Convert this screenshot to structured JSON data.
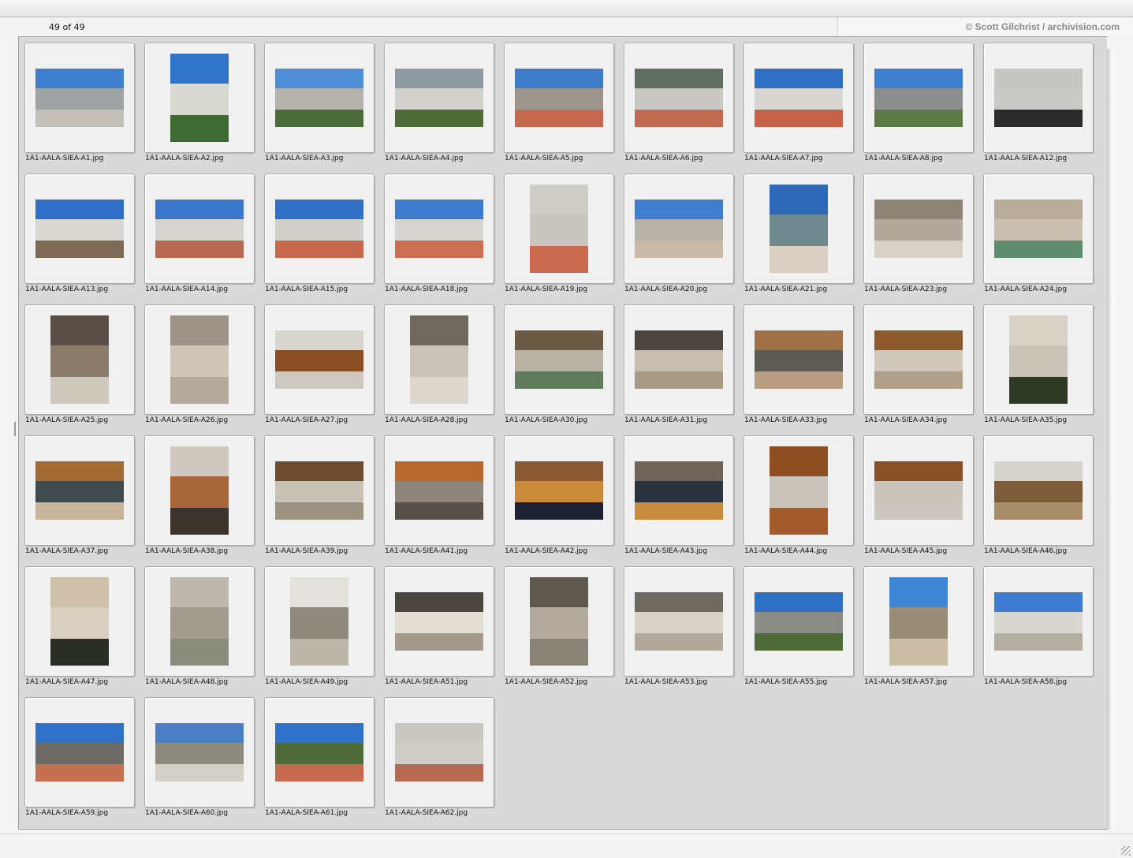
{
  "header": {
    "counter": "49 of 49",
    "credit": "© Scott Gilchrist / archivision.com"
  },
  "thumbnails": [
    {
      "file": "1A1-AALA-SIEA-A1.jpg",
      "orientation": "landscape",
      "colors": [
        "#3e7fd0",
        "#9fa3a4",
        "#c4c0b8"
      ]
    },
    {
      "file": "1A1-AALA-SIEA-A2.jpg",
      "orientation": "portrait",
      "colors": [
        "#2f74c9",
        "#d9d9d4",
        "#3f6a34"
      ]
    },
    {
      "file": "1A1-AALA-SIEA-A3.jpg",
      "orientation": "landscape",
      "colors": [
        "#4f8fd8",
        "#b5b2ab",
        "#4a6b3a"
      ]
    },
    {
      "file": "1A1-AALA-SIEA-A4.jpg",
      "orientation": "landscape",
      "colors": [
        "#8e9a9f",
        "#d2d0cb",
        "#4d6b36"
      ]
    },
    {
      "file": "1A1-AALA-SIEA-A5.jpg",
      "orientation": "landscape",
      "colors": [
        "#3d7cc8",
        "#9d958c",
        "#c56a4e"
      ]
    },
    {
      "file": "1A1-AALA-SIEA-A6.jpg",
      "orientation": "landscape",
      "colors": [
        "#5f6e60",
        "#c9c8c3",
        "#c26a52"
      ]
    },
    {
      "file": "1A1-AALA-SIEA-A7.jpg",
      "orientation": "landscape",
      "colors": [
        "#2f6fc5",
        "#d8d7d2",
        "#c56348"
      ]
    },
    {
      "file": "1A1-AALA-SIEA-A8.jpg",
      "orientation": "landscape",
      "colors": [
        "#3d7fcf",
        "#8b8e8c",
        "#5b7a45"
      ]
    },
    {
      "file": "1A1-AALA-SIEA-A12.jpg",
      "orientation": "landscape",
      "colors": [
        "#c6c6c2",
        "#c9c9c5",
        "#2b2b2b"
      ]
    },
    {
      "file": "1A1-AALA-SIEA-A13.jpg",
      "orientation": "landscape",
      "colors": [
        "#2f6ec7",
        "#d9d8d3",
        "#7c6a52"
      ]
    },
    {
      "file": "1A1-AALA-SIEA-A14.jpg",
      "orientation": "landscape",
      "colors": [
        "#3b78cb",
        "#d6d4cf",
        "#b86a50"
      ]
    },
    {
      "file": "1A1-AALA-SIEA-A15.jpg",
      "orientation": "landscape",
      "colors": [
        "#2f6fc6",
        "#d1cfc9",
        "#c7674c"
      ]
    },
    {
      "file": "1A1-AALA-SIEA-A18.jpg",
      "orientation": "landscape",
      "colors": [
        "#3d7bcc",
        "#d7d5d0",
        "#cb6e51"
      ]
    },
    {
      "file": "1A1-AALA-SIEA-A19.jpg",
      "orientation": "portrait",
      "colors": [
        "#cfcdc7",
        "#c9c6c0",
        "#c9694d"
      ]
    },
    {
      "file": "1A1-AALA-SIEA-A20.jpg",
      "orientation": "landscape",
      "colors": [
        "#3f7ecf",
        "#b7b2a8",
        "#cbb9a8"
      ]
    },
    {
      "file": "1A1-AALA-SIEA-A21.jpg",
      "orientation": "portrait",
      "colors": [
        "#2f6ab9",
        "#6f8a8f",
        "#d8cfc2"
      ]
    },
    {
      "file": "1A1-AALA-SIEA-A23.jpg",
      "orientation": "landscape",
      "colors": [
        "#8f8576",
        "#b1a999",
        "#d8d2c6"
      ]
    },
    {
      "file": "1A1-AALA-SIEA-A24.jpg",
      "orientation": "landscape",
      "colors": [
        "#b8ab97",
        "#c8bfb0",
        "#5f8c6f"
      ]
    },
    {
      "file": "1A1-AALA-SIEA-A25.jpg",
      "orientation": "portrait",
      "colors": [
        "#5b5047",
        "#8d7c6c",
        "#cfc8bd"
      ]
    },
    {
      "file": "1A1-AALA-SIEA-A26.jpg",
      "orientation": "portrait",
      "colors": [
        "#9c9486",
        "#cfc6b7",
        "#b4aa9a"
      ]
    },
    {
      "file": "1A1-AALA-SIEA-A27.jpg",
      "orientation": "landscape",
      "colors": [
        "#d9d6cf",
        "#8a4f22",
        "#cdc9c1"
      ]
    },
    {
      "file": "1A1-AALA-SIEA-A28.jpg",
      "orientation": "portrait",
      "colors": [
        "#6f685f",
        "#c9c3b9",
        "#ddd8cf"
      ]
    },
    {
      "file": "1A1-AALA-SIEA-A30.jpg",
      "orientation": "landscape",
      "colors": [
        "#6c5a45",
        "#b9b1a4",
        "#5f7d5c"
      ]
    },
    {
      "file": "1A1-AALA-SIEA-A31.jpg",
      "orientation": "landscape",
      "colors": [
        "#4a463f",
        "#c7bfae",
        "#a89a85"
      ]
    },
    {
      "file": "1A1-AALA-SIEA-A33.jpg",
      "orientation": "landscape",
      "colors": [
        "#a07046",
        "#5c5a52",
        "#b79d82"
      ]
    },
    {
      "file": "1A1-AALA-SIEA-A34.jpg",
      "orientation": "landscape",
      "colors": [
        "#8d5a2d",
        "#cfc8bb",
        "#b09e86"
      ]
    },
    {
      "file": "1A1-AALA-SIEA-A35.jpg",
      "orientation": "portrait",
      "colors": [
        "#d8d1c5",
        "#c9c2b6",
        "#2f3a25"
      ]
    },
    {
      "file": "1A1-AALA-SIEA-A37.jpg",
      "orientation": "landscape",
      "colors": [
        "#a46a34",
        "#3f4a4c",
        "#c9b59b"
      ]
    },
    {
      "file": "1A1-AALA-SIEA-A38.jpg",
      "orientation": "portrait",
      "colors": [
        "#cfcac1",
        "#a7673a",
        "#3a342d"
      ]
    },
    {
      "file": "1A1-AALA-SIEA-A39.jpg",
      "orientation": "landscape",
      "colors": [
        "#6d4c2f",
        "#c8c2b5",
        "#9c9280"
      ]
    },
    {
      "file": "1A1-AALA-SIEA-A41.jpg",
      "orientation": "landscape",
      "colors": [
        "#b8672d",
        "#8d857a",
        "#565049"
      ]
    },
    {
      "file": "1A1-AALA-SIEA-A42.jpg",
      "orientation": "landscape",
      "colors": [
        "#8a5a32",
        "#c98a3a",
        "#1d2233"
      ]
    },
    {
      "file": "1A1-AALA-SIEA-A43.jpg",
      "orientation": "landscape",
      "colors": [
        "#6d6356",
        "#2b3240",
        "#c78b3f"
      ]
    },
    {
      "file": "1A1-AALA-SIEA-A44.jpg",
      "orientation": "portrait",
      "colors": [
        "#8d4f22",
        "#c9c5bd",
        "#a25c2c"
      ]
    },
    {
      "file": "1A1-AALA-SIEA-A45.jpg",
      "orientation": "landscape",
      "colors": [
        "#8a5025",
        "#c9c5bd",
        "#cbc7c0"
      ]
    },
    {
      "file": "1A1-AALA-SIEA-A46.jpg",
      "orientation": "landscape",
      "colors": [
        "#d6d3cc",
        "#7d5c3a",
        "#a88d6c"
      ]
    },
    {
      "file": "1A1-AALA-SIEA-A47.jpg",
      "orientation": "portrait",
      "colors": [
        "#cdbfa8",
        "#d8cfbf",
        "#2a2d24"
      ]
    },
    {
      "file": "1A1-AALA-SIEA-A48.jpg",
      "orientation": "portrait",
      "colors": [
        "#bdb7ae",
        "#a29b90",
        "#8a8d7e"
      ]
    },
    {
      "file": "1A1-AALA-SIEA-A49.jpg",
      "orientation": "portrait",
      "colors": [
        "#e3e1dc",
        "#8e887d",
        "#bdb6aa"
      ]
    },
    {
      "file": "1A1-AALA-SIEA-A51.jpg",
      "orientation": "landscape",
      "colors": [
        "#4a463f",
        "#e2ddd2",
        "#a39a8b"
      ]
    },
    {
      "file": "1A1-AALA-SIEA-A52.jpg",
      "orientation": "portrait",
      "colors": [
        "#5d574e",
        "#b3ab9f",
        "#8a8478"
      ]
    },
    {
      "file": "1A1-AALA-SIEA-A53.jpg",
      "orientation": "landscape",
      "colors": [
        "#6f6a61",
        "#d8d3c9",
        "#b1aa9c"
      ]
    },
    {
      "file": "1A1-AALA-SIEA-A55.jpg",
      "orientation": "landscape",
      "colors": [
        "#2e70c6",
        "#8b8c86",
        "#4c6b37"
      ]
    },
    {
      "file": "1A1-AALA-SIEA-A57.jpg",
      "orientation": "portrait",
      "colors": [
        "#3f85d6",
        "#9a8d78",
        "#cbbca5"
      ]
    },
    {
      "file": "1A1-AALA-SIEA-A58.jpg",
      "orientation": "landscape",
      "colors": [
        "#3d7cd0",
        "#d9d7cf",
        "#b4aea3"
      ]
    },
    {
      "file": "1A1-AALA-SIEA-A59.jpg",
      "orientation": "landscape",
      "colors": [
        "#2f70c8",
        "#6e6b66",
        "#c5714f"
      ]
    },
    {
      "file": "1A1-AALA-SIEA-A60.jpg",
      "orientation": "landscape",
      "colors": [
        "#4a7fc5",
        "#8c8a80",
        "#d3d0c8"
      ]
    },
    {
      "file": "1A1-AALA-SIEA-A61.jpg",
      "orientation": "landscape",
      "colors": [
        "#2f72cb",
        "#4f6b3a",
        "#c56a4c"
      ]
    },
    {
      "file": "1A1-AALA-SIEA-A62.jpg",
      "orientation": "landscape",
      "colors": [
        "#c9c7c1",
        "#cfccc6",
        "#b36a4f"
      ]
    }
  ]
}
